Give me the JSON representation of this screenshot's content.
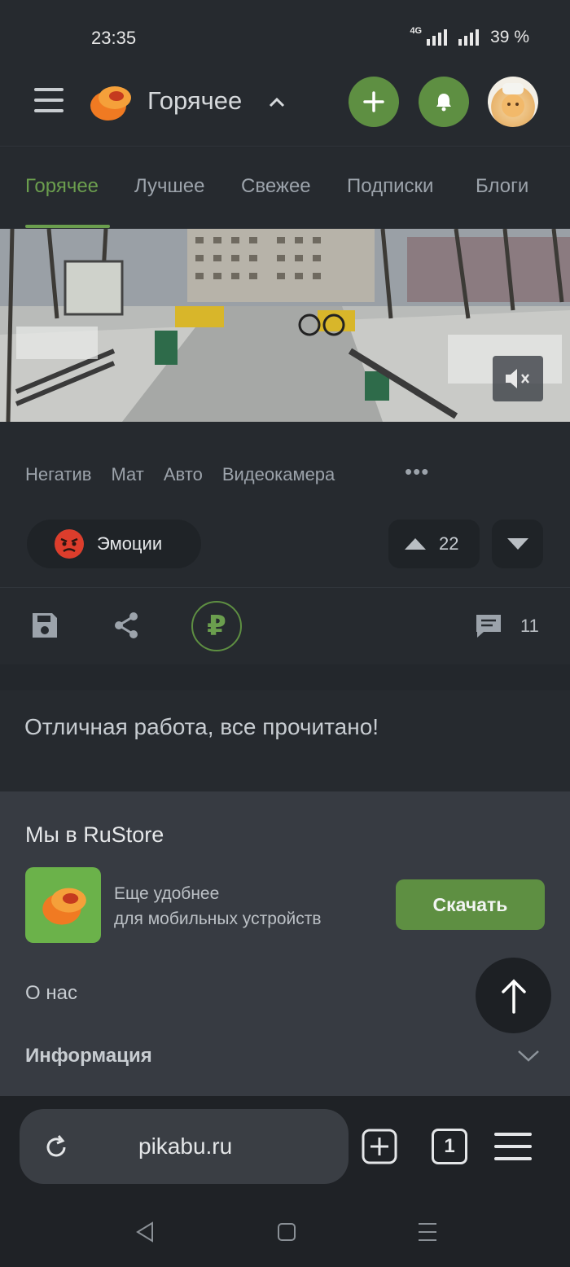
{
  "status_bar": {
    "time": "23:35",
    "network": "4G",
    "battery": "39 %"
  },
  "header": {
    "title": "Горячее",
    "icons": {
      "menu": "hamburger-icon",
      "add": "plus-icon",
      "notifications": "bell-icon",
      "avatar": "user-avatar"
    },
    "accent_color": "#5e8f42"
  },
  "tabs": [
    {
      "label": "Горячее",
      "active": true
    },
    {
      "label": "Лучшее",
      "active": false
    },
    {
      "label": "Свежее",
      "active": false
    },
    {
      "label": "Подписки",
      "active": false
    },
    {
      "label": "Блоги",
      "active": false
    }
  ],
  "post": {
    "tags": [
      "Негатив",
      "Мат",
      "Авто",
      "Видеокамера"
    ],
    "more": "•••",
    "community": "Эмоции",
    "rating": "22",
    "donate_symbol": "₽",
    "comments": "11"
  },
  "done_message": "Отличная работа, все прочитано!",
  "footer": {
    "rustore_title": "Мы в RuStore",
    "rustore_line1": "Еще удобнее",
    "rustore_line2": "для мобильных устройств",
    "download_label": "Скачать",
    "about_label": "О нас",
    "info_label": "Информация"
  },
  "browser": {
    "url": "pikabu.ru",
    "tab_count": "1"
  }
}
